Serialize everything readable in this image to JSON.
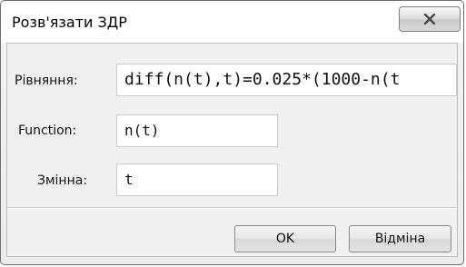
{
  "window": {
    "title": "Розв'язати ЗДР",
    "close_icon": "close-icon"
  },
  "form": {
    "equation": {
      "label": "Рівняння:",
      "value": "diff(n(t),t)=0.025*(1000-n(t"
    },
    "function": {
      "label": "Function:",
      "value": "n(t)"
    },
    "variable": {
      "label": "Змінна:",
      "value": "t"
    }
  },
  "buttons": {
    "ok": "OK",
    "cancel": "Відміна"
  }
}
